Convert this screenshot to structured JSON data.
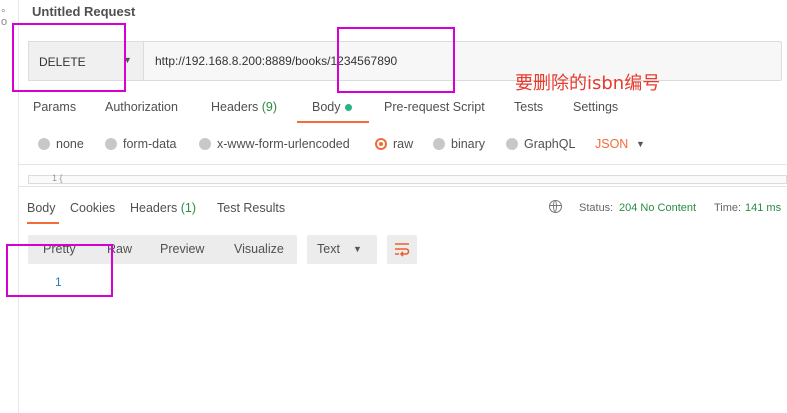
{
  "request": {
    "title": "Untitled Request",
    "method": "DELETE",
    "url": "http://192.168.8.200:8889/books/1234567890"
  },
  "annotation": "要删除的isbn编号",
  "request_tabs": [
    {
      "label": "Params"
    },
    {
      "label": "Authorization"
    },
    {
      "label": "Headers",
      "count": "(9)"
    },
    {
      "label": "Body",
      "active": true
    },
    {
      "label": "Pre-request Script"
    },
    {
      "label": "Tests"
    },
    {
      "label": "Settings"
    }
  ],
  "body_types": {
    "options": [
      "none",
      "form-data",
      "x-www-form-urlencoded",
      "raw",
      "binary",
      "GraphQL"
    ],
    "selected": "raw",
    "format": "JSON"
  },
  "editor": {
    "line": "1  {"
  },
  "response_tabs": [
    {
      "label": "Body",
      "active": true
    },
    {
      "label": "Cookies"
    },
    {
      "label": "Headers",
      "count": "(1)"
    },
    {
      "label": "Test Results"
    }
  ],
  "status": {
    "label": "Status:",
    "value": "204 No Content"
  },
  "time": {
    "label": "Time:",
    "value": "141 ms"
  },
  "view_tabs": [
    "Pretty",
    "Raw",
    "Preview",
    "Visualize"
  ],
  "view_format": "Text",
  "response_body": {
    "line": "1"
  },
  "colors": {
    "accent": "#f26b3a",
    "highlight": "#d600d6",
    "annotation": "#e83a2e",
    "success": "#2a8c43"
  }
}
